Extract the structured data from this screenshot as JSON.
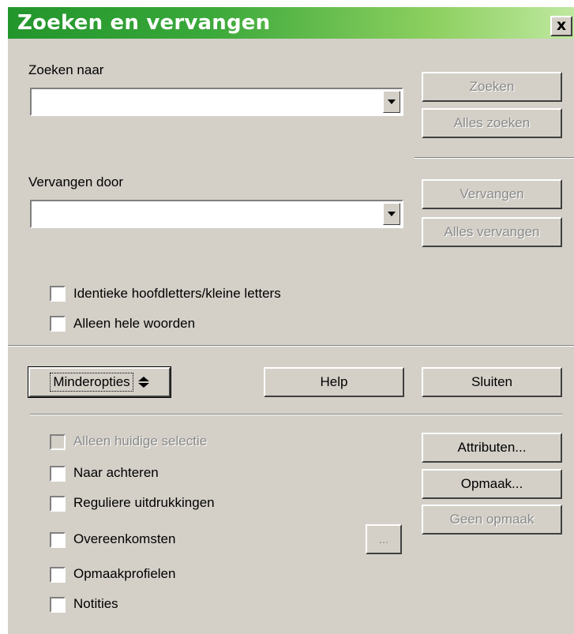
{
  "dialog": {
    "title": "Zoeken en vervangen",
    "close_label": "x"
  },
  "search": {
    "label": "Zoeken naar",
    "value": "",
    "find_button": "Zoeken",
    "find_all_button": "Alles zoeken"
  },
  "replace": {
    "label": "Vervangen door",
    "value": "",
    "replace_button": "Vervangen",
    "replace_all_button": "Alles vervangen"
  },
  "options": {
    "match_case": {
      "label": "Identieke hoofdletters/kleine letters",
      "checked": false
    },
    "whole_words": {
      "label": "Alleen hele woorden",
      "checked": false
    }
  },
  "buttons": {
    "fewer_options": "Minderopties",
    "help": "Help",
    "close": "Sluiten"
  },
  "more_options": {
    "current_selection": {
      "label": "Alleen huidige selectie",
      "checked": false,
      "enabled": false
    },
    "backwards": {
      "label": "Naar achteren",
      "checked": false
    },
    "regex": {
      "label": "Reguliere uitdrukkingen",
      "checked": false
    },
    "similarity": {
      "label": "Overeenkomsten",
      "checked": false
    },
    "similarity_dots": "...",
    "styles": {
      "label": "Opmaakprofielen",
      "checked": false
    },
    "notes": {
      "label": "Notities",
      "checked": false
    },
    "attributes_button": "Attributen...",
    "format_button": "Opmaak...",
    "no_format_button": "Geen opmaak"
  },
  "colors": {
    "dialog_bg": "#d4d0c8",
    "title_gradient_start": "#22952c",
    "title_gradient_end": "#bfe8a0",
    "disabled_text": "#8a8a8a"
  }
}
